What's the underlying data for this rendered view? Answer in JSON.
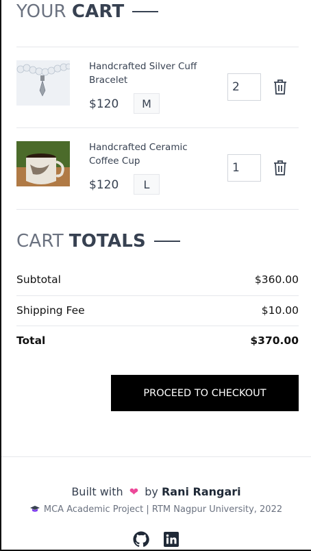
{
  "cart": {
    "title_light": "YOUR",
    "title_bold": "CART",
    "items": [
      {
        "name": "Handcrafted Silver Cuff Bracelet",
        "price": "$120",
        "size": "M",
        "quantity": "2",
        "image_icon": "bracelet-photo"
      },
      {
        "name": "Handcrafted Ceramic Coffee Cup",
        "price": "$120",
        "size": "L",
        "quantity": "1",
        "image_icon": "mug-photo"
      }
    ]
  },
  "totals": {
    "title_light": "CART",
    "title_bold": "TOTALS",
    "subtotal_label": "Subtotal",
    "subtotal_value": "$360.00",
    "shipping_label": "Shipping Fee",
    "shipping_value": "$10.00",
    "total_label": "Total",
    "total_value": "$370.00",
    "checkout_label": "PROCEED TO CHECKOUT"
  },
  "footer": {
    "built_prefix": "Built with",
    "built_heart": "❤",
    "built_by": "by",
    "author": "Rani Rangari",
    "academic": "MCA Academic Project | RTM Nagpur University, 2022",
    "icons": [
      "graduation-cap-icon",
      "github-icon",
      "linkedin-icon"
    ]
  },
  "colors": {
    "accent": "#000000",
    "heart": "#ec4899",
    "text": "#374151"
  }
}
